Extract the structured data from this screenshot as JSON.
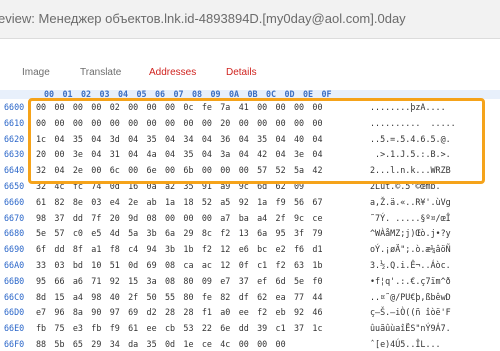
{
  "window": {
    "title": "eview: Менеджер объектов.lnk.id-4893894D.[my0day@aol.com].0day"
  },
  "tabs": [
    {
      "label": "Image",
      "color": "#6d6d6d"
    },
    {
      "label": "Translate",
      "color": "#6d6d6d"
    },
    {
      "label": "Addresses",
      "color": "#d0231f"
    },
    {
      "label": "Details",
      "color": "#d0231f"
    }
  ],
  "hex_header": [
    "00",
    "01",
    "02",
    "03",
    "04",
    "05",
    "06",
    "07",
    "08",
    "09",
    "0A",
    "0B",
    "0C",
    "0D",
    "0E",
    "0F"
  ],
  "rows": [
    {
      "off": "6600",
      "hex": "00 00 00 00 02 00 00 00 0c fe 7a 41 00 00 00 00",
      "asc": "........þzA...."
    },
    {
      "off": "6610",
      "hex": "00 00 00 00 00 00 00 00 00 00 20 00 00 00 00 00",
      "asc": "..........  ....."
    },
    {
      "off": "6620",
      "hex": "1c 04 35 04 3d 04 35 04 34 04 36 04 35 04 40 04",
      "asc": "..5.=.5.4.6.5.@."
    },
    {
      "off": "6630",
      "hex": "20 00 3e 04 31 04 4a 04 35 04 3a 04 42 04 3e 04",
      "asc": " .>.1.J.5.:.B.>."
    },
    {
      "off": "6640",
      "hex": "32 04 2e 00 6c 00 6e 00 6b 00 00 00 57 52 5a 42",
      "asc": "2...l.n.k...WRZB"
    },
    {
      "off": "6650",
      "hex": "32 4c fc 74 0d 16 0a a2 35 91 a9 9c 6d 62 09",
      "asc": "2Lüt.©.5‘©œmb."
    },
    {
      "off": "6660",
      "hex": "61 82 8e 03 e4 2e ab 1a 18 52 a5 92 1a f9 56 67",
      "asc": "a‚Ž.ä.«..R¥'.ùVg"
    },
    {
      "off": "6670",
      "hex": "98 37 dd 7f 20 9d 08 00 00 00 a7 ba a4 2f 9c ce",
      "asc": "˜7Ý. .....§º¤/œÎ"
    },
    {
      "off": "6680",
      "hex": "5e 57 c0 e5 4d 5a 3b 6a 29 8c f2 13 6a 95 3f 79",
      "asc": "^WÀåMZ;j)Œò.j•?y"
    },
    {
      "off": "6690",
      "hex": "6f dd 8f a1 f8 c4 94 3b 1b f2 12 e6 bc e2 f6 d1",
      "asc": "oÝ.¡øÄ\";.ò.æ¼âöÑ"
    },
    {
      "off": "66A0",
      "hex": "33 03 bd 10 51 0d 69 08 ca ac 12 0f c1 f2 63 1b",
      "asc": "3.½.Q.i.Ê¬..Áòc."
    },
    {
      "off": "66B0",
      "hex": "95 66 a6 71 92 15 3a 08 80 09 e7 37 ef 6d 5e f0",
      "asc": "•f¦q'.:.€.ç7ïm^ð"
    },
    {
      "off": "66C0",
      "hex": "8d 15 a4 98 40 2f 50 55 80 fe 82 df 62 ea 77 44",
      "asc": "..¤˜@/PU€þ‚ßbêwD"
    },
    {
      "off": "66D0",
      "hex": "e7 96 8a 90 97 69 d2 28 28 f1 a0 ee f2 eb 92 46",
      "asc": "ç–Š.—iÒ((ñ îòë'F"
    },
    {
      "off": "66E0",
      "hex": "fb 75 e3 fb f9 61 ee cb 53 22 6e dd 39 c1 37 1c",
      "asc": "ûuãûùaîËS\"nÝ9Á7."
    },
    {
      "off": "66F0",
      "hex": "88 5b 65 29 34 da 35 0d 1e ce 4c 00 00 00",
      "asc": "ˆ[e)4Ú5..ÎL..."
    }
  ]
}
